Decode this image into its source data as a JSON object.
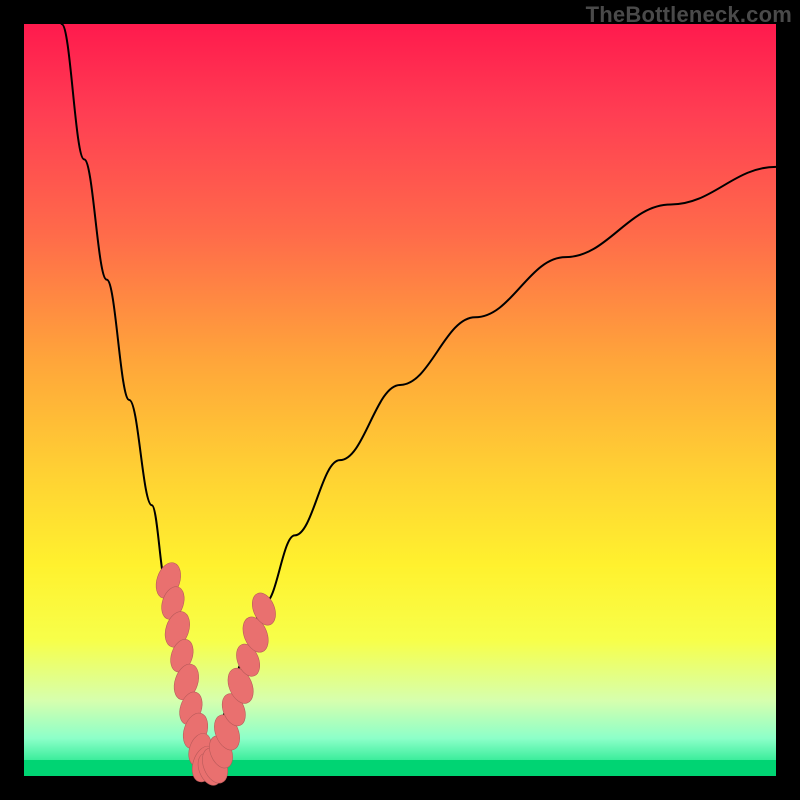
{
  "watermark": "TheBottleneck.com",
  "colors": {
    "gradient_top": "#ff1a4d",
    "gradient_bottom": "#00e07a",
    "curve": "#000000",
    "blob_fill": "#e9706f",
    "blob_stroke": "#b85a5a",
    "frame": "#000000"
  },
  "chart_data": {
    "type": "line",
    "title": "",
    "xlabel": "",
    "ylabel": "",
    "xlim": [
      0,
      100
    ],
    "ylim": [
      0,
      100
    ],
    "grid": false,
    "note": "Bottleneck-style V curve; values are estimated from pixel positions (0=bottom, 100=top). Minimum near x≈24.",
    "series": [
      {
        "name": "left-branch",
        "x": [
          5,
          8,
          11,
          14,
          17,
          19,
          21,
          22.5,
          23.5,
          24.3
        ],
        "y": [
          100,
          82,
          66,
          50,
          36,
          25,
          15,
          8,
          3,
          0
        ]
      },
      {
        "name": "right-branch",
        "x": [
          24.3,
          25.5,
          27,
          29,
          32,
          36,
          42,
          50,
          60,
          72,
          86,
          100
        ],
        "y": [
          0,
          4,
          9,
          15,
          23,
          32,
          42,
          52,
          61,
          69,
          76,
          81
        ]
      }
    ],
    "markers": {
      "note": "Pink rounded blobs clustered near the curve trough on both branches",
      "points": [
        {
          "x": 19.2,
          "y": 26,
          "r": 2.4
        },
        {
          "x": 19.8,
          "y": 23,
          "r": 2.2
        },
        {
          "x": 20.4,
          "y": 19.5,
          "r": 2.4
        },
        {
          "x": 21.0,
          "y": 16,
          "r": 2.2
        },
        {
          "x": 21.6,
          "y": 12.5,
          "r": 2.4
        },
        {
          "x": 22.2,
          "y": 9,
          "r": 2.2
        },
        {
          "x": 22.8,
          "y": 6,
          "r": 2.4
        },
        {
          "x": 23.4,
          "y": 3.5,
          "r": 2.2
        },
        {
          "x": 24.0,
          "y": 1.6,
          "r": 2.4
        },
        {
          "x": 24.7,
          "y": 0.9,
          "r": 2.2
        },
        {
          "x": 25.4,
          "y": 1.4,
          "r": 2.4
        },
        {
          "x": 26.2,
          "y": 3.2,
          "r": 2.2
        },
        {
          "x": 27.0,
          "y": 5.8,
          "r": 2.4
        },
        {
          "x": 27.9,
          "y": 8.8,
          "r": 2.2
        },
        {
          "x": 28.8,
          "y": 12.0,
          "r": 2.4
        },
        {
          "x": 29.8,
          "y": 15.4,
          "r": 2.2
        },
        {
          "x": 30.8,
          "y": 18.8,
          "r": 2.4
        },
        {
          "x": 31.9,
          "y": 22.2,
          "r": 2.2
        }
      ]
    }
  }
}
